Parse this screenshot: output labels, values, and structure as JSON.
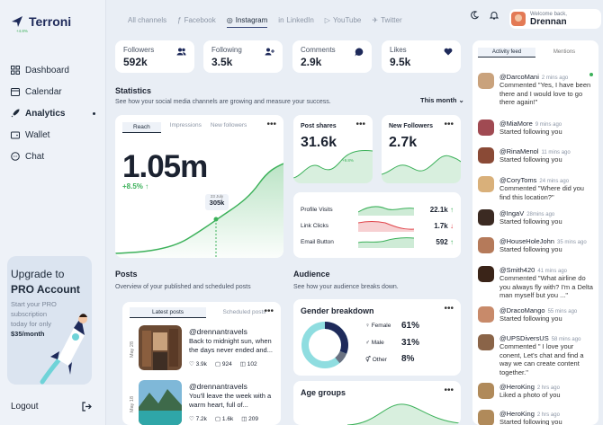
{
  "app": {
    "name": "Terroni"
  },
  "nav": [
    {
      "label": "Dashboard",
      "icon": "grid-icon"
    },
    {
      "label": "Calendar",
      "icon": "calendar-icon"
    },
    {
      "label": "Analytics",
      "icon": "rocket-icon",
      "active": true
    },
    {
      "label": "Wallet",
      "icon": "wallet-icon"
    },
    {
      "label": "Chat",
      "icon": "chat-icon"
    }
  ],
  "promo": {
    "title_pre": "Upgrade to",
    "title_bold": "PRO Account",
    "text": "Start your PRO subscription today for only",
    "price": "$35/month"
  },
  "logout": "Logout",
  "channels": [
    "All channels",
    "Facebook",
    "Instagram",
    "LinkedIn",
    "YouTube",
    "Twitter"
  ],
  "active_channel": "Instagram",
  "user": {
    "greeting": "Welcome back,",
    "name": "Drennan"
  },
  "stats": [
    {
      "label": "Followers",
      "value": "592k",
      "icon": "users-icon"
    },
    {
      "label": "Following",
      "value": "3.5k",
      "icon": "user-add-icon"
    },
    {
      "label": "Comments",
      "value": "2.9k",
      "icon": "comment-icon"
    },
    {
      "label": "Likes",
      "value": "9.5k",
      "icon": "heart-icon"
    }
  ],
  "statistics": {
    "title": "Statistics",
    "subtitle": "See how your social media channels are growing and measure your success.",
    "period": "This month",
    "reach": {
      "tabs": [
        "Reach",
        "Impressions",
        "New followers"
      ],
      "value": "1.05m",
      "change": "+8.5%",
      "tooltip_date": "23 July",
      "tooltip_value": "305k"
    },
    "post_shares": {
      "title": "Post shares",
      "value": "31.6k",
      "change": "+9.8%"
    },
    "new_followers": {
      "title": "New Followers",
      "value": "2.7k",
      "change": "+4.8%"
    },
    "metrics": [
      {
        "label": "Profile Visits",
        "value": "22.1k",
        "trend": "up"
      },
      {
        "label": "Link Clicks",
        "value": "1.7k",
        "trend": "down"
      },
      {
        "label": "Email Button",
        "value": "592",
        "trend": "up"
      }
    ]
  },
  "posts": {
    "title": "Posts",
    "subtitle": "Overview of your published and scheduled posts",
    "tabs": [
      "Latest posts",
      "Scheduled posts"
    ],
    "items": [
      {
        "date": "May 28",
        "user": "@drennantravels",
        "text": "Back to midnight sun, when the days never ended and...",
        "likes": "3.9k",
        "comments": "924",
        "saves": "102"
      },
      {
        "date": "May 18",
        "user": "@drennantravels",
        "text": "You'll leave the week with a warm heart, full of...",
        "likes": "7.2k",
        "comments": "1.6k",
        "saves": "209"
      }
    ]
  },
  "audience": {
    "title": "Audience",
    "subtitle": "See how your audience breaks down.",
    "gender": {
      "title": "Gender breakdown",
      "rows": [
        {
          "label": "Female",
          "value": "61%"
        },
        {
          "label": "Male",
          "value": "31%"
        },
        {
          "label": "Other",
          "value": "8%"
        }
      ]
    },
    "age": {
      "title": "Age groups"
    }
  },
  "feed": {
    "tabs": [
      "Activity feed",
      "Mentions"
    ],
    "items": [
      {
        "user": "@DarcoMani",
        "time": "2 mins ago",
        "text": "Commented \"Yes, I have been there and I would love to go there again!\"",
        "color": "#c9a27c"
      },
      {
        "user": "@MiaMore",
        "time": "9 mins ago",
        "text": "Started following you",
        "color": "#a04a52"
      },
      {
        "user": "@RinaMenol",
        "time": "11 mins ago",
        "text": "Started following you",
        "color": "#8a4a36"
      },
      {
        "user": "@CoryToms",
        "time": "24 mins ago",
        "text": "Commented \"Where did you find this location?\"",
        "color": "#d9b07a"
      },
      {
        "user": "@IngaV",
        "time": "28mins ago",
        "text": "Started following you",
        "color": "#3b2a22"
      },
      {
        "user": "@HouseHoleJohn",
        "time": "35 mins ago",
        "text": "Started following you",
        "color": "#b57a5a"
      },
      {
        "user": "@Smith420",
        "time": "41 mins ago",
        "text": "Commented \"What airline do you always fly with? I'm a Delta man myself but you ...\"",
        "color": "#3a2418"
      },
      {
        "user": "@DracoMango",
        "time": "55 mins ago",
        "text": "Started following you",
        "color": "#c88a6a"
      },
      {
        "user": "@UPSDiversUS",
        "time": "58 mins ago",
        "text": "Commented \" I love your conent, Let's chat and find a way we can create content together.\"",
        "color": "#8a6448"
      },
      {
        "user": "@HeroKing",
        "time": "2 hrs ago",
        "text": "Liked a photo of you",
        "color": "#b08a5a"
      },
      {
        "user": "@HeroKing",
        "time": "2 hrs ago",
        "text": "Started following you",
        "color": "#b08a5a"
      }
    ]
  }
}
